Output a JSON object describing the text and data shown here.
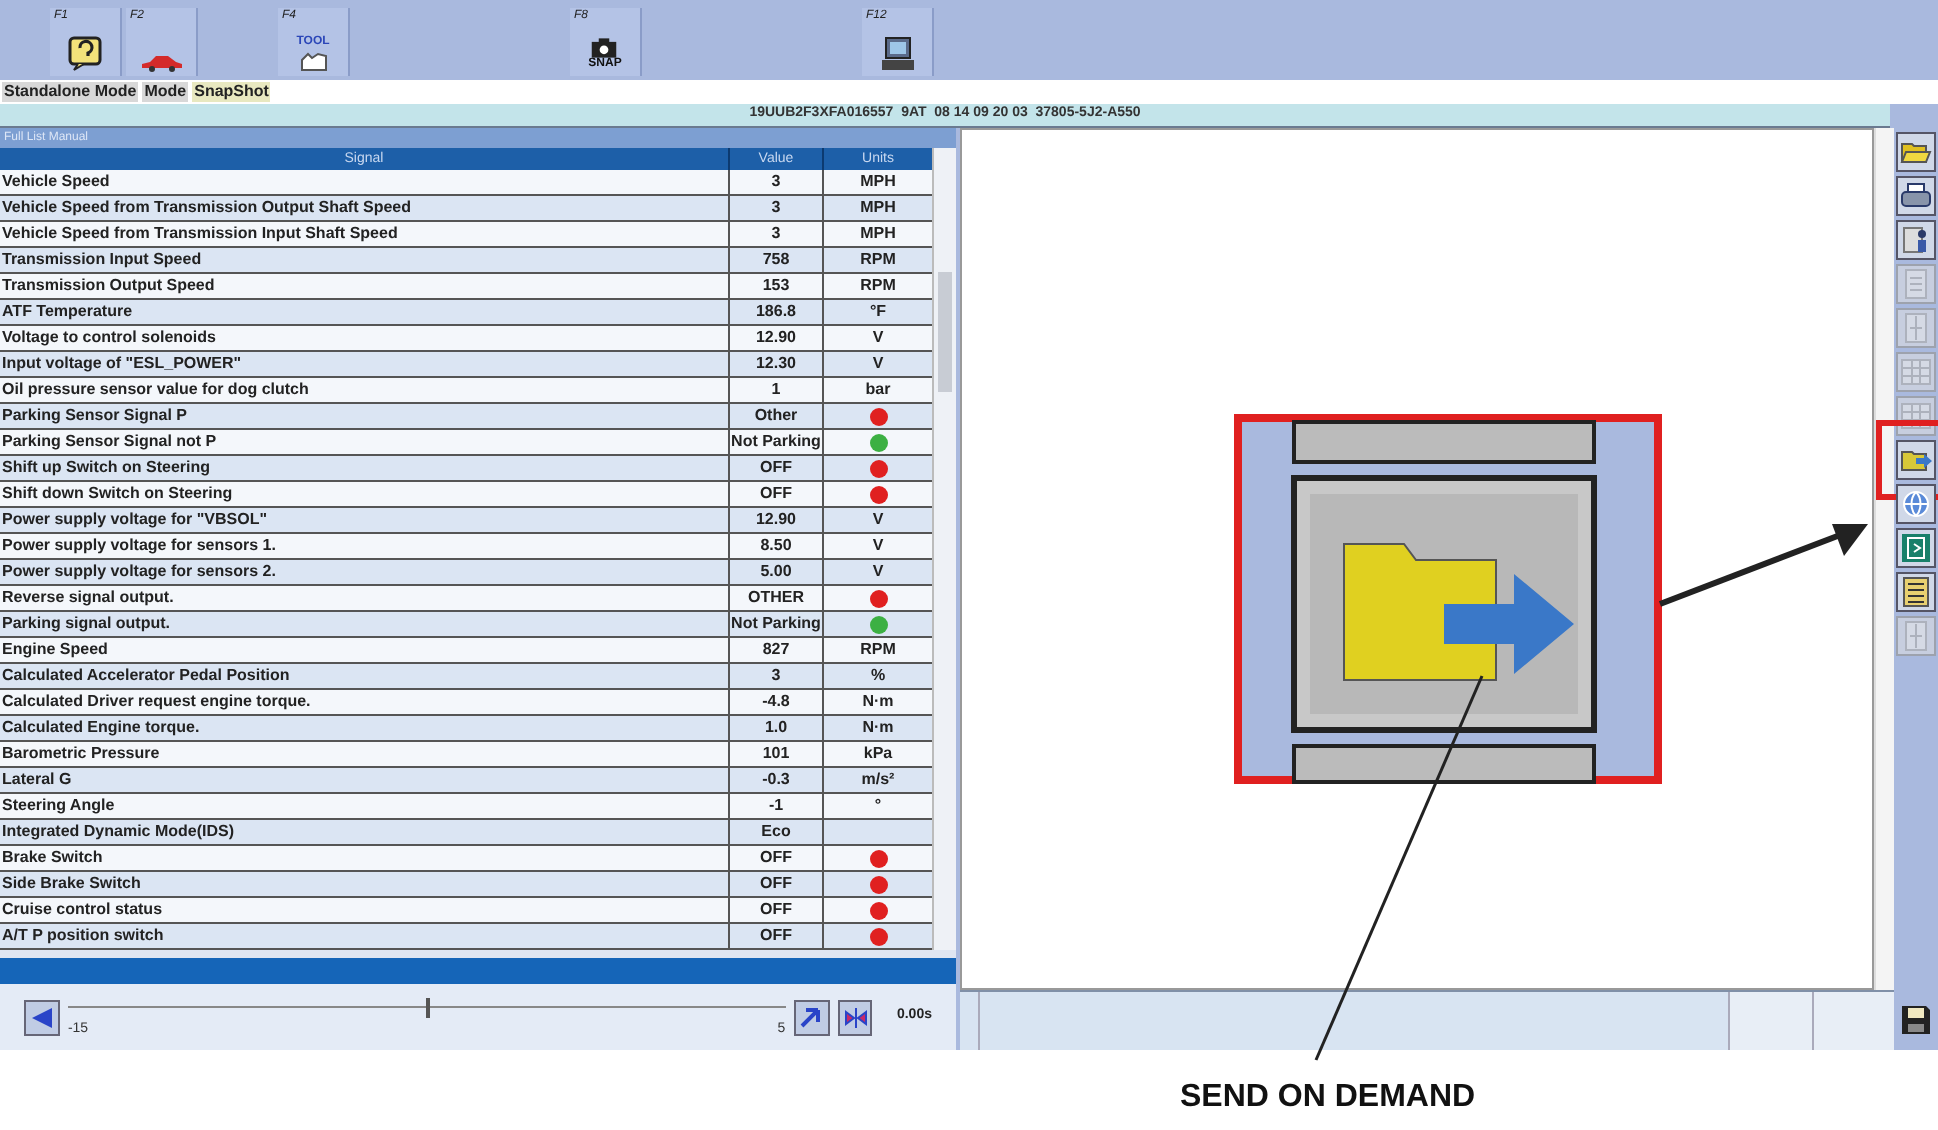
{
  "toolbar": [
    {
      "key": "F1",
      "kind": "help"
    },
    {
      "key": "F2",
      "kind": "car"
    },
    {
      "key": "F4",
      "kind": "tool",
      "caption": "TOOL"
    },
    {
      "key": "F8",
      "kind": "snap",
      "caption": "SNAP"
    },
    {
      "key": "F12",
      "kind": "computer"
    }
  ],
  "mode_bar": [
    "Standalone Mode",
    "Mode",
    "SnapShot"
  ],
  "vehicle_info": "19UUB2F3XFA016557  9AT  08 14 09 20 03  37805-5J2-A550",
  "list": {
    "title": "Full List Manual",
    "columns": [
      "Signal",
      "Value",
      "Units"
    ],
    "rows": [
      {
        "signal": "Vehicle Speed",
        "value": "3",
        "units": "MPH"
      },
      {
        "signal": "Vehicle Speed from Transmission Output Shaft Speed",
        "value": "3",
        "units": "MPH"
      },
      {
        "signal": "Vehicle Speed from Transmission Input Shaft Speed",
        "value": "3",
        "units": "MPH"
      },
      {
        "signal": "Transmission Input Speed",
        "value": "758",
        "units": "RPM"
      },
      {
        "signal": "Transmission Output Speed",
        "value": "153",
        "units": "RPM"
      },
      {
        "signal": "ATF Temperature",
        "value": "186.8",
        "units": "°F"
      },
      {
        "signal": "Voltage to control solenoids",
        "value": "12.90",
        "units": "V"
      },
      {
        "signal": "Input voltage of  \"ESL_POWER\"",
        "value": "12.30",
        "units": "V"
      },
      {
        "signal": "Oil pressure sensor value for dog clutch",
        "value": "1",
        "units": "bar"
      },
      {
        "signal": "Parking Sensor Signal P",
        "value": "Other",
        "color": "#e02020"
      },
      {
        "signal": "Parking Sensor Signal not P",
        "value": "Not Parking",
        "color": "#3cb043"
      },
      {
        "signal": "Shift up Switch on Steering",
        "value": "OFF",
        "color": "#e02020"
      },
      {
        "signal": "Shift down Switch on Steering",
        "value": "OFF",
        "color": "#e02020"
      },
      {
        "signal": "Power supply voltage for \"VBSOL\"",
        "value": "12.90",
        "units": "V"
      },
      {
        "signal": "Power supply voltage for sensors 1.",
        "value": "8.50",
        "units": "V"
      },
      {
        "signal": "Power supply voltage for sensors 2.",
        "value": "5.00",
        "units": "V"
      },
      {
        "signal": "Reverse signal output.",
        "value": "OTHER",
        "color": "#e02020"
      },
      {
        "signal": "Parking signal output.",
        "value": "Not Parking",
        "color": "#3cb043"
      },
      {
        "signal": "Engine Speed",
        "value": "827",
        "units": "RPM"
      },
      {
        "signal": "Calculated Accelerator Pedal Position",
        "value": "3",
        "units": "%"
      },
      {
        "signal": "Calculated Driver request engine torque.",
        "value": "-4.8",
        "units": "N·m"
      },
      {
        "signal": "Calculated Engine torque.",
        "value": "1.0",
        "units": "N·m"
      },
      {
        "signal": "Barometric Pressure",
        "value": "101",
        "units": "kPa"
      },
      {
        "signal": "Lateral G",
        "value": "-0.3",
        "units": "m/s²"
      },
      {
        "signal": "Steering Angle",
        "value": "-1",
        "units": "°"
      },
      {
        "signal": "Integrated Dynamic Mode(IDS)",
        "value": "Eco"
      },
      {
        "signal": "Brake Switch",
        "value": "OFF",
        "color": "#e02020"
      },
      {
        "signal": "Side Brake Switch",
        "value": "OFF",
        "color": "#e02020"
      },
      {
        "signal": "Cruise control status",
        "value": "OFF",
        "color": "#e02020"
      },
      {
        "signal": "A/T P position switch",
        "value": "OFF",
        "color": "#e02020"
      }
    ]
  },
  "timeline": {
    "start": "-15",
    "end": "5",
    "level": 0.5,
    "time": "0.00s"
  },
  "side_tools": [
    {
      "kind": "open",
      "disabled": false,
      "highlighted": false
    },
    {
      "kind": "print",
      "disabled": false,
      "highlighted": false
    },
    {
      "kind": "person",
      "disabled": false,
      "highlighted": false
    },
    {
      "kind": "page",
      "disabled": true,
      "highlighted": false
    },
    {
      "kind": "split",
      "disabled": true,
      "highlighted": false
    },
    {
      "kind": "grid",
      "disabled": true,
      "highlighted": false
    },
    {
      "kind": "grid",
      "disabled": true,
      "highlighted": false
    },
    {
      "kind": "send",
      "disabled": false,
      "highlighted": true
    },
    {
      "kind": "globe",
      "disabled": false,
      "highlighted": false
    },
    {
      "kind": "exit",
      "disabled": false,
      "highlighted": false
    },
    {
      "kind": "list",
      "disabled": false,
      "highlighted": false
    },
    {
      "kind": "split",
      "disabled": true,
      "highlighted": false
    }
  ],
  "callout": {
    "label": "SEND ON DEMAND"
  }
}
